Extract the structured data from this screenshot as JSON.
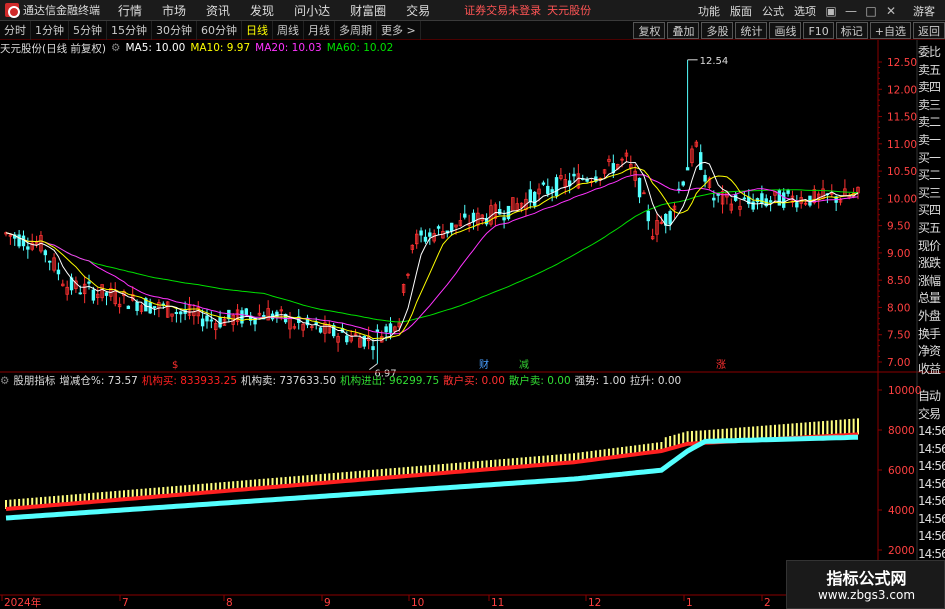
{
  "app_title": "通达信金融终端",
  "menu": [
    "行情",
    "市场",
    "资讯",
    "发现",
    "问小达",
    "财富圈",
    "交易"
  ],
  "login_status": "证券交易未登录",
  "top_stock_name": "天元股份",
  "top_right": [
    "功能",
    "版面",
    "公式",
    "选项"
  ],
  "guest_label": "游客",
  "periods": [
    "分时",
    "1分钟",
    "5分钟",
    "15分钟",
    "30分钟",
    "60分钟",
    "日线",
    "周线",
    "月线",
    "多周期",
    "更多 >"
  ],
  "active_period": "日线",
  "toolbar_right": [
    "复权",
    "叠加",
    "多股",
    "统计",
    "画线",
    "F10",
    "标记",
    "+自选",
    "返回"
  ],
  "chart_info": {
    "stock": "天元股份(日线 前复权)",
    "ma5": "MA5: 10.00",
    "ma10": "MA10: 9.97",
    "ma20": "MA20: 10.03",
    "ma60": "MA60: 10.02"
  },
  "indicator": {
    "name": "股朋指标",
    "zjc": "增减仓%: 73.57",
    "jgm": "机构买: 833933.25",
    "jgs": "机构卖: 737633.50",
    "jgjc": "机构进出: 96299.75",
    "shm": "散户买: 0.00",
    "shs": "散户卖: 0.00",
    "qs": "强势: 1.00",
    "ls": "拉升: 0.00"
  },
  "right_panel": [
    "委比",
    "卖五",
    "卖四",
    "卖三",
    "卖二",
    "卖一",
    "买一",
    "买二",
    "买三",
    "买四",
    "买五",
    "现价",
    "涨跌",
    "涨幅",
    "总量",
    "外盘",
    "换手",
    "净资",
    "收益"
  ],
  "right_panel2": [
    "自动",
    "交易",
    "14:56",
    "14:56",
    "14:56",
    "14:56",
    "14:56",
    "14:56",
    "14:56",
    "14:56",
    "14:56"
  ],
  "price_axis": [
    "12.50",
    "12.00",
    "11.50",
    "11.00",
    "10.50",
    "10.00",
    "9.50",
    "9.00",
    "8.50",
    "8.00",
    "7.50",
    "7.00"
  ],
  "ind_axis": [
    "10000",
    "8000",
    "6000",
    "4000",
    "2000"
  ],
  "date_axis": [
    "2024年",
    "7",
    "8",
    "9",
    "10",
    "11",
    "12",
    "1",
    "2"
  ],
  "high_label": "12.54",
  "low_label": "6.97",
  "event_marks": [
    {
      "text": "$",
      "color": "#ff3030"
    },
    {
      "text": "财",
      "color": "#4aa0ff"
    },
    {
      "text": "减",
      "color": "#33cc33"
    },
    {
      "text": "涨",
      "color": "#ff3030"
    }
  ],
  "colors": {
    "up": "#ff3232",
    "down": "#54ffff",
    "ma5": "#ffffff",
    "ma10": "#ffff00",
    "ma20": "#ff33ff",
    "ma60": "#00e000",
    "ind_bar": "#ffff80",
    "ind_red": "#ff2020",
    "ind_cyan": "#54ffff",
    "axis_line": "#8a0000"
  },
  "watermark": {
    "title": "指标公式网",
    "url": "www.zbgs3.com"
  }
}
